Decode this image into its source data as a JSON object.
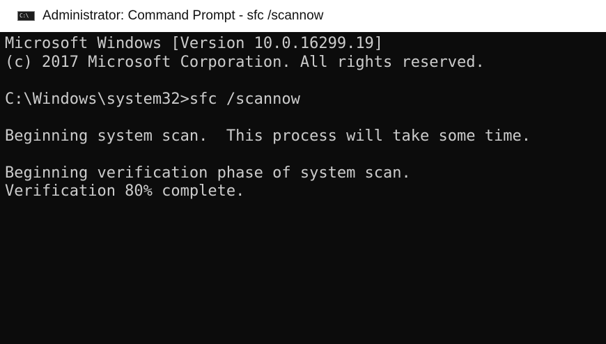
{
  "window": {
    "title": "Administrator: Command Prompt - sfc  /scannow",
    "icon_name": "console-icon",
    "icon_label": "C:\\"
  },
  "console": {
    "background_color": "#0c0c0c",
    "text_color": "#cccccc",
    "lines": [
      "Microsoft Windows [Version 10.0.16299.19]",
      "(c) 2017 Microsoft Corporation. All rights reserved.",
      "",
      "C:\\Windows\\system32>sfc /scannow",
      "",
      "Beginning system scan.  This process will take some time.",
      "",
      "Beginning verification phase of system scan.",
      "Verification 80% complete."
    ]
  }
}
